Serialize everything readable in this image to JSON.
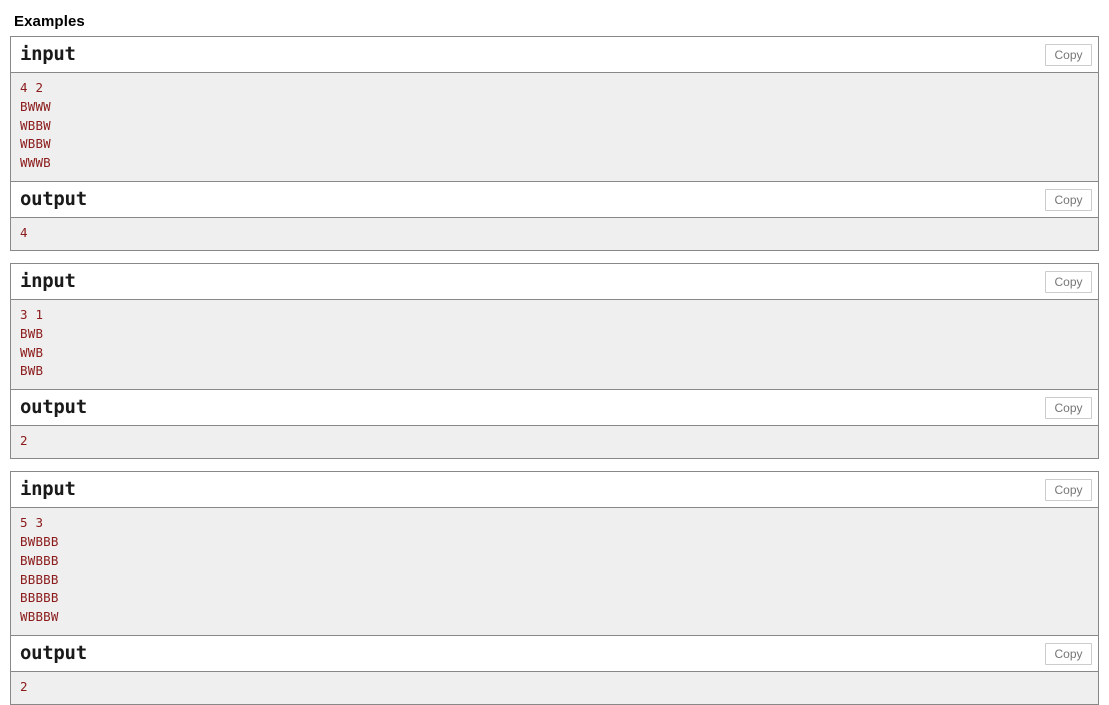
{
  "section": {
    "title": "Examples"
  },
  "labels": {
    "input": "input",
    "output": "output",
    "copy": "Copy"
  },
  "colors": {
    "code_text": "#8b1a1a",
    "body_background": "#efefef",
    "border": "#888888",
    "copy_button_text": "#767676",
    "copy_button_border": "#cccccc"
  },
  "examples": [
    {
      "input": "4 2\nBWWW\nWBBW\nWBBW\nWWWB",
      "output": "4"
    },
    {
      "input": "3 1\nBWB\nWWB\nBWB",
      "output": "2"
    },
    {
      "input": "5 3\nBWBBB\nBWBBB\nBBBBB\nBBBBB\nWBBBW",
      "output": "2"
    }
  ]
}
